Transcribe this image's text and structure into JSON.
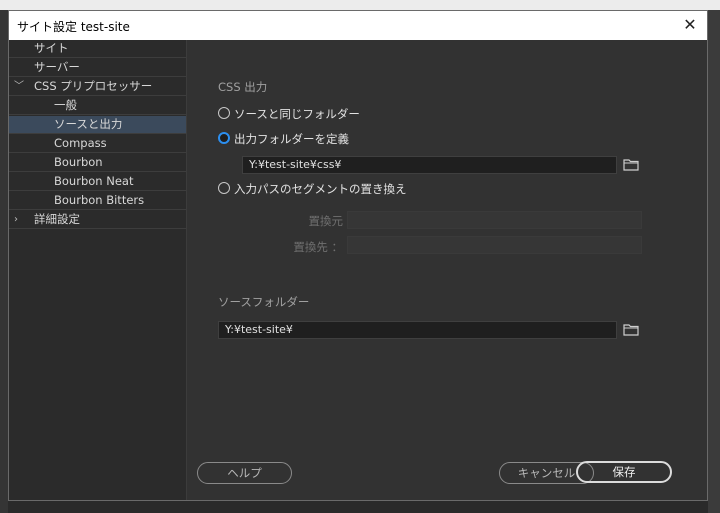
{
  "window": {
    "title": "サイト設定 test-site",
    "close_glyph": "✕"
  },
  "sidebar": {
    "items": [
      {
        "label": "サイト",
        "chevron": ""
      },
      {
        "label": "サーバー",
        "chevron": ""
      },
      {
        "label": "CSS プリプロセッサー",
        "chevron": "﹀"
      },
      {
        "label": "一般",
        "chevron": ""
      },
      {
        "label": "ソースと出力",
        "chevron": ""
      },
      {
        "label": "Compass",
        "chevron": ""
      },
      {
        "label": "Bourbon",
        "chevron": ""
      },
      {
        "label": "Bourbon Neat",
        "chevron": ""
      },
      {
        "label": "Bourbon Bitters",
        "chevron": ""
      },
      {
        "label": "詳細設定",
        "chevron": "›"
      }
    ]
  },
  "main": {
    "css_output_label": "CSS 出力",
    "options": [
      {
        "label": "ソースと同じフォルダー",
        "checked": false
      },
      {
        "label": "出力フォルダーを定義",
        "checked": true
      },
      {
        "label": "入力パスのセグメントの置き換え",
        "checked": false
      }
    ],
    "output_path": "Y:¥test-site¥css¥",
    "replace_label": "置換元",
    "replace_with_label": "置換先 ：",
    "source_folder_label": "ソースフォルダー",
    "source_path": "Y:¥test-site¥"
  },
  "footer": {
    "help": "ヘルプ",
    "cancel": "キャンセル",
    "save": "保存"
  },
  "colors": {
    "accent": "#2c8ff0",
    "selected_row": "#3b4a5c"
  }
}
